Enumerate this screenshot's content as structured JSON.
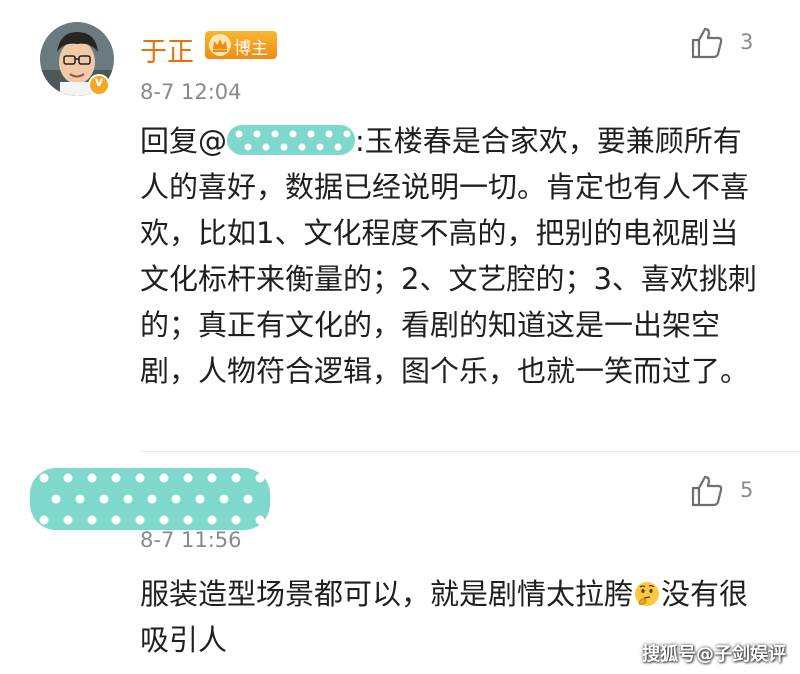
{
  "comments": [
    {
      "username": "于正",
      "badge": "博主",
      "time": "8-7 12:04",
      "likes": "3",
      "reply_prefix": "回复@",
      "text": ":玉楼春是合家欢，要兼顾所有人的喜好，数据已经说明一切。肯定也有人不喜欢，比如1、文化程度不高的，把别的电视剧当文化标杆来衡量的；2、文艺腔的；3、喜欢挑刺的；真正有文化的，看剧的知道这是一出架空剧，人物符合逻辑，图个乐，也就一笑而过了。"
    },
    {
      "time": "8-7 11:56",
      "likes": "5",
      "text_before_emoji": "服装造型场景都可以，就是剧情太拉胯",
      "text_after_emoji": "没有很吸引人"
    }
  ],
  "watermark": "搜狐号@子剑娱评",
  "colors": {
    "username": "#e5730c",
    "badge": "#f08b12",
    "mask": "#7fd8cc",
    "meta": "#8a8a8a"
  },
  "icons": [
    "thumbs-up-icon",
    "crown-icon",
    "verified-v-icon",
    "thinking-emoji-icon"
  ]
}
